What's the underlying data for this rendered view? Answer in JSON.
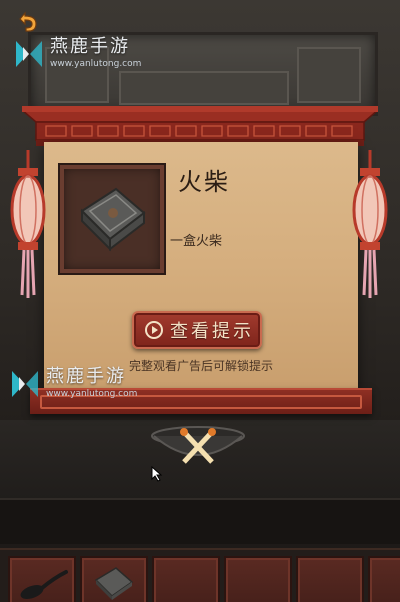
{
  "watermark": {
    "name": "燕鹿手游",
    "url": "www.yanlutong.com"
  },
  "hint_dialog": {
    "item_name": "火柴",
    "item_description": "一盒火柴",
    "view_hint_button": "查看提示",
    "ad_note": "完整观看广告后可解锁提示"
  },
  "inventory": {
    "slots": [
      {
        "item": "spoon-icon"
      },
      {
        "item": "matchbox-icon"
      },
      {
        "item": ""
      },
      {
        "item": ""
      },
      {
        "item": ""
      },
      {
        "item": ""
      }
    ]
  },
  "colors": {
    "dialog_paper": "#d5ae7e",
    "frame_red": "#8e2f23",
    "button_red": "#a23b2e"
  }
}
